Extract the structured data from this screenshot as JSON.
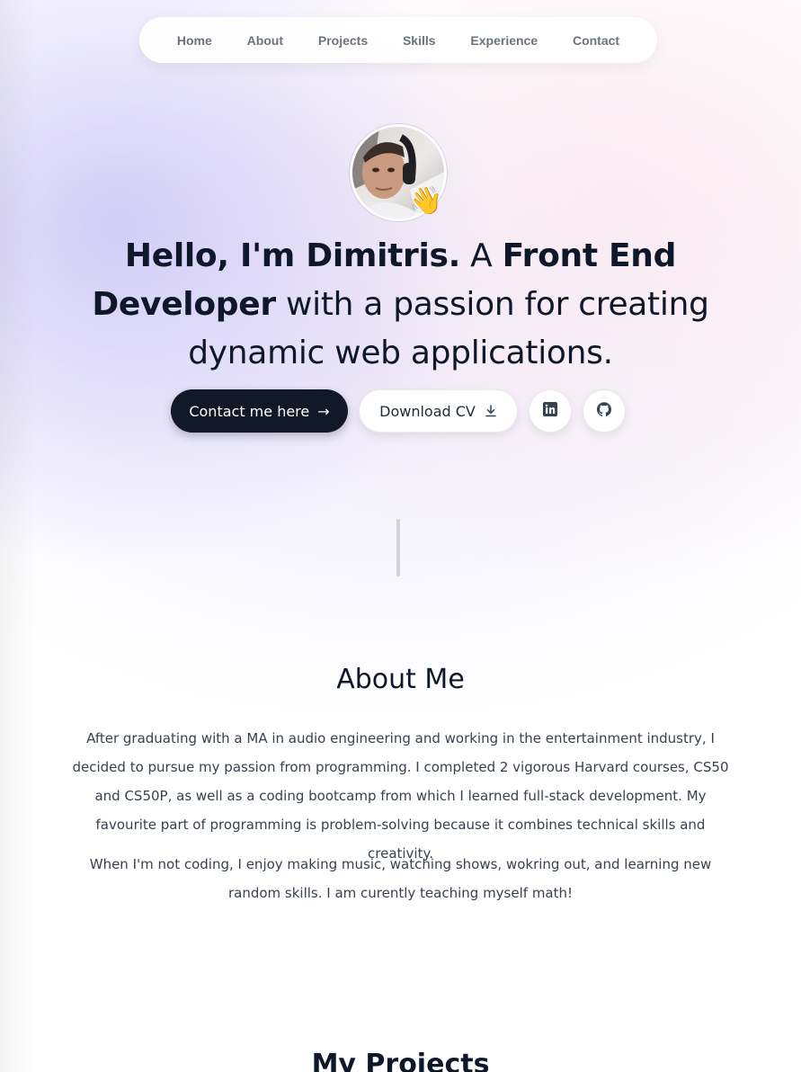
{
  "nav": {
    "items": [
      "Home",
      "About",
      "Projects",
      "Skills",
      "Experience",
      "Contact"
    ]
  },
  "hero": {
    "greeting_bold": "Hello, I'm Dimitris.",
    "connector": " A ",
    "role_bold": "Front End Developer",
    "rest": " with a passion for creating dynamic web applications.",
    "wave_emoji": "👋",
    "avatar_icon": "profile-photo"
  },
  "actions": {
    "contact_label": "Contact me here",
    "contact_arrow": "→",
    "cv_label": "Download CV",
    "linkedin_icon": "linkedin-icon",
    "github_icon": "github-icon"
  },
  "about": {
    "title": "About Me",
    "paragraph1": "After graduating with a MA in audio engineering and working in the entertainment industry, I decided to pursue my passion from programming. I completed 2 vigorous Harvard courses, CS50 and CS50P, as well as a coding bootcamp from which I learned full-stack development. My favourite part of programming is problem-solving because it combines technical skills and creativity.",
    "paragraph2": "When I'm not coding, I enjoy making music, watching shows, wokring out, and learning new random skills. I am curently teaching myself math!"
  },
  "projects": {
    "title": "My Projects"
  },
  "colors": {
    "primary_button": "#111827",
    "text": "#0f172a",
    "muted": "#6b7280"
  }
}
